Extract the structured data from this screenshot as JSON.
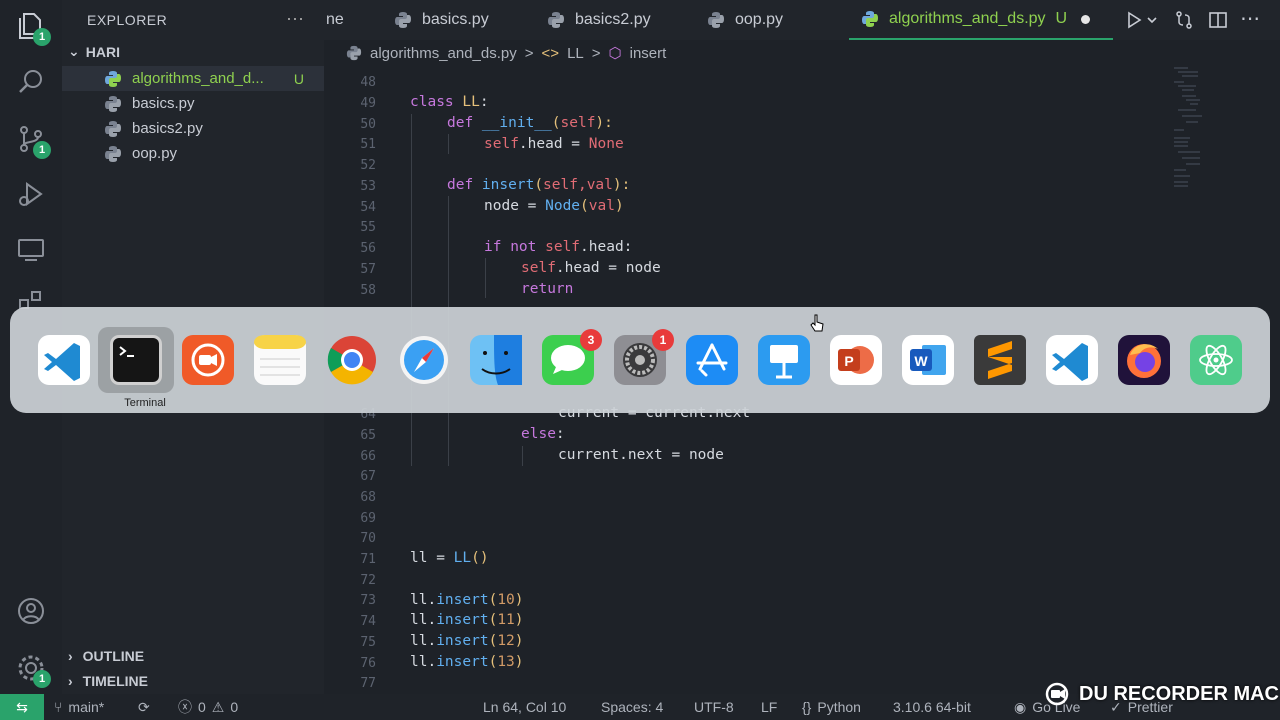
{
  "explorer": {
    "title": "EXPLORER",
    "more": "···",
    "folder": "HARI",
    "files": [
      {
        "name": "algorithms_and_d...",
        "status": "U"
      },
      {
        "name": "basics.py",
        "status": ""
      },
      {
        "name": "basics2.py",
        "status": ""
      },
      {
        "name": "oop.py",
        "status": ""
      }
    ],
    "outline": "OUTLINE",
    "timeline": "TIMELINE"
  },
  "activity": {
    "explorer_badge": "1",
    "scm_badge": "1",
    "settings_badge": "1"
  },
  "tabs": [
    {
      "label": "ne"
    },
    {
      "label": "basics.py"
    },
    {
      "label": "basics2.py"
    },
    {
      "label": "oop.py"
    },
    {
      "label": "algorithms_and_ds.py",
      "status": "U"
    }
  ],
  "breadcrumb": {
    "file": "algorithms_and_ds.py",
    "cls": "LL",
    "method": "insert",
    "sep": ">"
  },
  "editor": {
    "lines": [
      {
        "n": "48"
      },
      {
        "n": "49"
      },
      {
        "n": "50"
      },
      {
        "n": "51"
      },
      {
        "n": "52"
      },
      {
        "n": "53"
      },
      {
        "n": "54"
      },
      {
        "n": "55"
      },
      {
        "n": "56"
      },
      {
        "n": "57"
      },
      {
        "n": "58"
      },
      {
        "n": "64"
      },
      {
        "n": "65"
      },
      {
        "n": "66"
      },
      {
        "n": "67"
      },
      {
        "n": "68"
      },
      {
        "n": "69"
      },
      {
        "n": "70"
      },
      {
        "n": "71"
      },
      {
        "n": "72"
      },
      {
        "n": "73"
      },
      {
        "n": "74"
      },
      {
        "n": "75"
      },
      {
        "n": "76"
      },
      {
        "n": "77"
      }
    ],
    "code": {
      "l49a": "class ",
      "l49b": "LL",
      "l49c": ":",
      "l50a": "def ",
      "l50b": "__init__",
      "l50c": "(",
      "l50d": "self",
      "l50e": "):",
      "l51a": "self",
      "l51b": ".head = ",
      "l51c": "None",
      "l53a": "def ",
      "l53b": "insert",
      "l53c": "(",
      "l53d": "self,val",
      "l53e": "):",
      "l54a": "node = ",
      "l54b": "Node",
      "l54c": "(",
      "l54d": "val",
      "l54e": ")",
      "l56a": "if not ",
      "l56b": "self",
      "l56c": ".head:",
      "l57a": "self",
      "l57b": ".head = node",
      "l58a": "return",
      "l64a": "current = current.next",
      "l65a": "else",
      "l65b": ":",
      "l66a": "current.next = node",
      "l71a": "ll = ",
      "l71b": "LL",
      "l71c": "()",
      "l73a": "ll.",
      "l73b": "insert",
      "l73c": "(",
      "l73d": "10",
      "l73e": ")",
      "l74a": "ll.",
      "l74b": "insert",
      "l74c": "(",
      "l74d": "11",
      "l74e": ")",
      "l75a": "ll.",
      "l75b": "insert",
      "l75c": "(",
      "l75d": "12",
      "l75e": ")",
      "l76a": "ll.",
      "l76b": "insert",
      "l76c": "(",
      "l76d": "13",
      "l76e": ")"
    }
  },
  "dock": {
    "hover_label": "Terminal",
    "apps": [
      {
        "name": "vscode-icon"
      },
      {
        "name": "terminal-icon"
      },
      {
        "name": "du-recorder-icon"
      },
      {
        "name": "notes-icon"
      },
      {
        "name": "chrome-icon"
      },
      {
        "name": "safari-icon"
      },
      {
        "name": "finder-icon"
      },
      {
        "name": "messages-icon",
        "badge": "3"
      },
      {
        "name": "system-preferences-icon",
        "badge": "1"
      },
      {
        "name": "app-store-icon"
      },
      {
        "name": "keynote-icon"
      },
      {
        "name": "powerpoint-icon"
      },
      {
        "name": "word-icon"
      },
      {
        "name": "sublime-text-icon"
      },
      {
        "name": "vscode-icon-2"
      },
      {
        "name": "firefox-icon"
      },
      {
        "name": "atom-icon"
      }
    ]
  },
  "status": {
    "branch": "main*",
    "errors": "0",
    "warnings": "0",
    "position": "Ln 64, Col 10",
    "spaces": "Spaces: 4",
    "encoding": "UTF-8",
    "eol": "LF",
    "language": "Python",
    "interpreter": "3.10.6 64-bit",
    "golive": "Go Live",
    "prettier": "Prettier"
  },
  "watermark": "DU RECORDER MAC",
  "colors": {
    "accent": "#2aa36b",
    "modified": "#8fd14f",
    "background": "#1e2228"
  }
}
